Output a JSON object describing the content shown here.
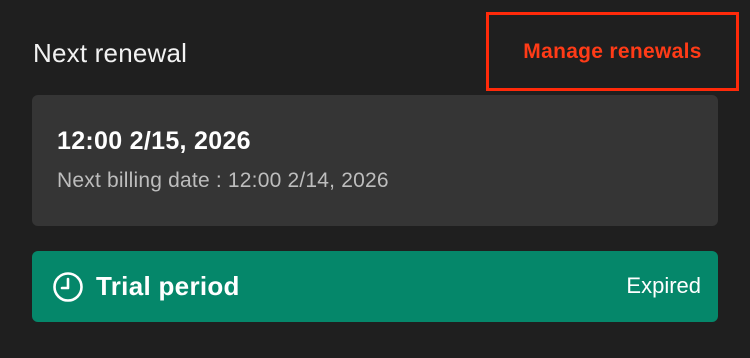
{
  "header": {
    "title": "Next renewal",
    "manage_link": "Manage renewals"
  },
  "renewal": {
    "date": "12:00 2/15, 2026",
    "billing": "Next billing date : 12:00 2/14, 2026"
  },
  "trial": {
    "icon": "clock-icon",
    "label": "Trial period",
    "status": "Expired"
  },
  "colors": {
    "background": "#1f1f1f",
    "card": "#353535",
    "accent_red": "#ff3b17",
    "trial_green": "#05876a"
  }
}
